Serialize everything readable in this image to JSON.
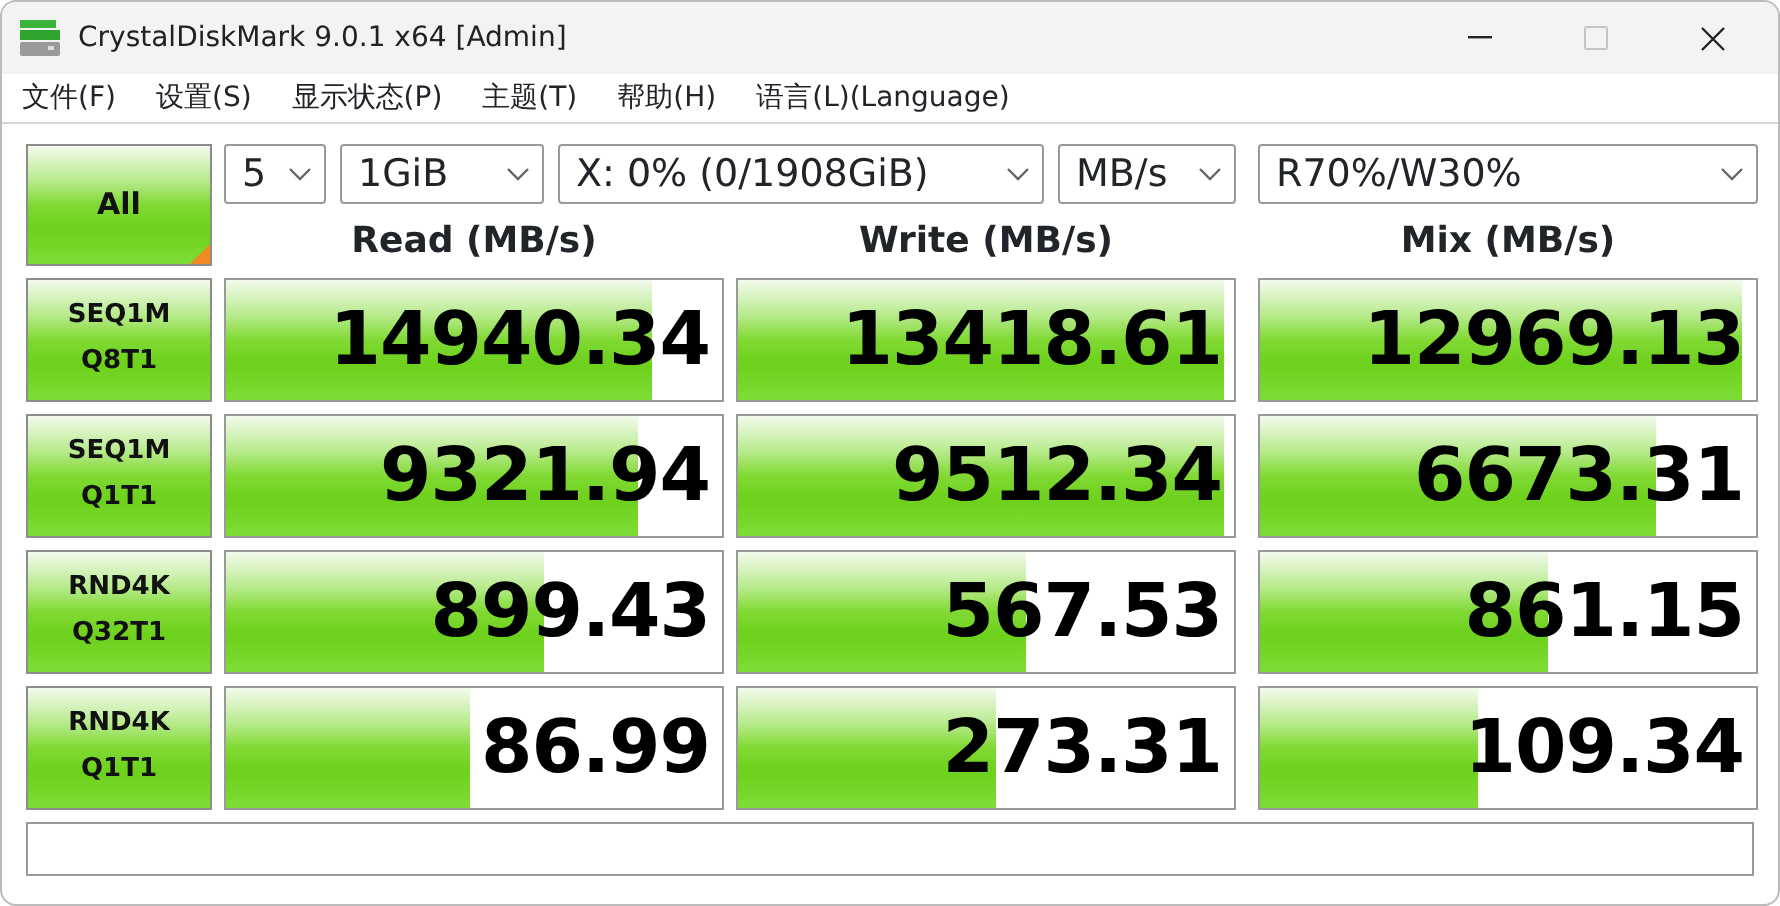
{
  "window": {
    "title": "CrystalDiskMark 9.0.1 x64 [Admin]",
    "maximize_disabled": true
  },
  "menu": [
    "文件(F)",
    "设置(S)",
    "显示状态(P)",
    "主题(T)",
    "帮助(H)",
    "语言(L)(Language)"
  ],
  "all_button": {
    "label": "All"
  },
  "settings": {
    "count": "5",
    "size": "1GiB",
    "drive": "X: 0% (0/1908GiB)",
    "unit": "MB/s",
    "mix": "R70%/W30%"
  },
  "columns": [
    "Read (MB/s)",
    "Write (MB/s)",
    "Mix (MB/s)"
  ],
  "tests": [
    {
      "name": "SEQ1M",
      "params": "Q8T1",
      "results": [
        {
          "value": "14940.34",
          "level": 0.86
        },
        {
          "value": "13418.61",
          "level": 0.98
        },
        {
          "value": "12969.13",
          "level": 0.97
        }
      ]
    },
    {
      "name": "SEQ1M",
      "params": "Q1T1",
      "results": [
        {
          "value": "9321.94",
          "level": 0.83
        },
        {
          "value": "9512.34",
          "level": 0.98
        },
        {
          "value": "6673.31",
          "level": 0.8
        }
      ]
    },
    {
      "name": "RND4K",
      "params": "Q32T1",
      "results": [
        {
          "value": "899.43",
          "level": 0.64
        },
        {
          "value": "567.53",
          "level": 0.58
        },
        {
          "value": "861.15",
          "level": 0.58
        }
      ]
    },
    {
      "name": "RND4K",
      "params": "Q1T1",
      "results": [
        {
          "value": "86.99",
          "level": 0.49
        },
        {
          "value": "273.31",
          "level": 0.52
        },
        {
          "value": "109.34",
          "level": 0.44
        }
      ]
    }
  ]
}
